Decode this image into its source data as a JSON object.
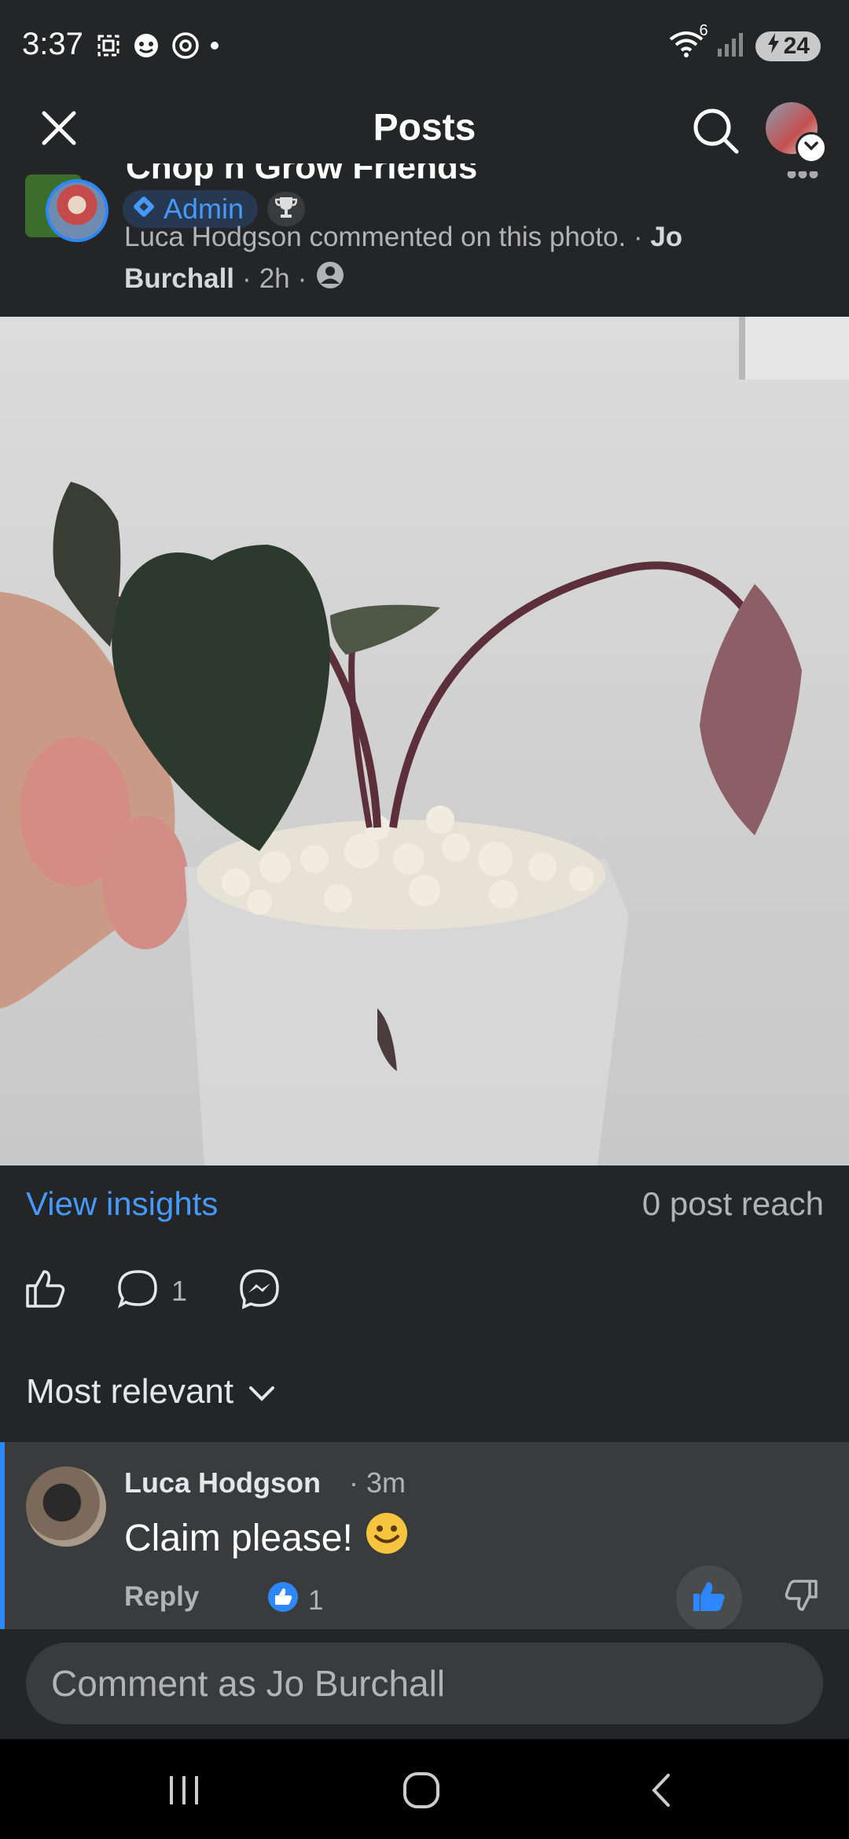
{
  "status_bar": {
    "time": "3:37",
    "battery": "24",
    "network_badge": "6"
  },
  "header": {
    "title": "Posts"
  },
  "post": {
    "group_name": "Chop n Grow Friends",
    "admin_badge": "Admin",
    "meta_commented": "Luca Hodgson commented on this photo.",
    "meta_author_first": "Jo",
    "meta_author_last": "Burchall",
    "meta_time": "2h",
    "meta_sep": "·"
  },
  "insights": {
    "view_label": "View insights",
    "reach": "0 post reach"
  },
  "actions": {
    "comment_count": "1"
  },
  "comments": {
    "sort_label": "Most relevant",
    "items": [
      {
        "author": "Luca Hodgson",
        "time": "· 3m",
        "text": "Claim please!",
        "reply_label": "Reply",
        "reaction_count": "1"
      }
    ]
  },
  "composer": {
    "placeholder": "Comment as Jo Burchall"
  },
  "colors": {
    "accent": "#2d88ff",
    "link": "#4599ff",
    "background": "#242526",
    "card": "#3a3b3c"
  }
}
